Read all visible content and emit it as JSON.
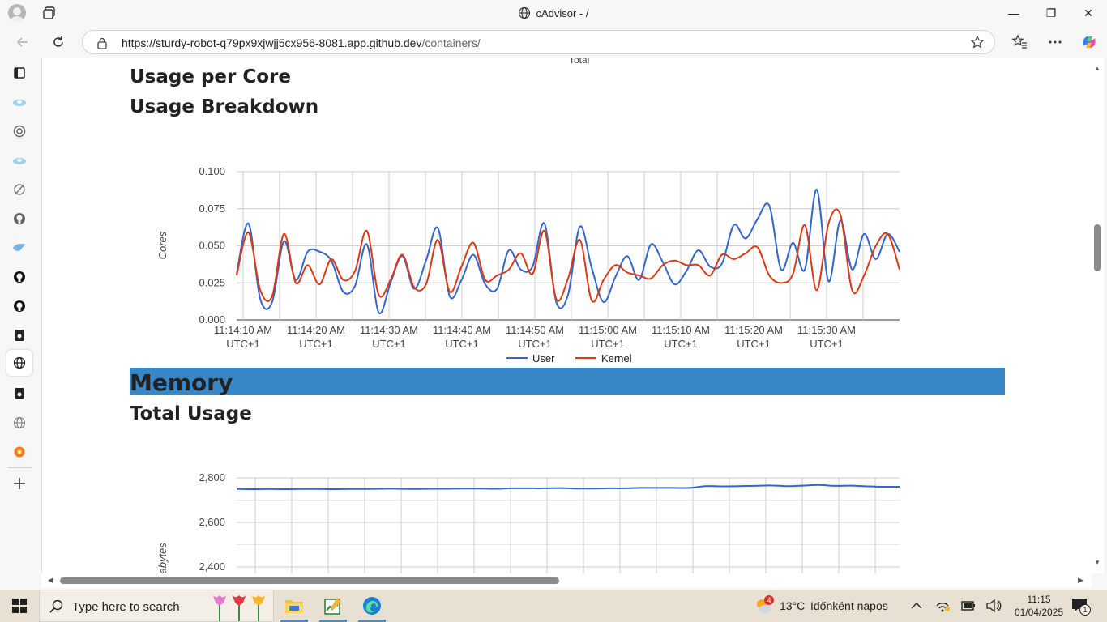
{
  "window": {
    "title": "cAdvisor - /",
    "minimize": "—",
    "maximize": "❐",
    "close": "✕"
  },
  "address": {
    "url_host": "https://sturdy-robot-q79px9xjwjj5cx956-8081.app.github.dev",
    "url_path": "/containers/"
  },
  "page": {
    "cut_label": "Total",
    "usage_per_core": "Usage per Core",
    "usage_breakdown": "Usage Breakdown",
    "memory_section": "Memory",
    "total_usage": "Total Usage"
  },
  "chart_data": [
    {
      "type": "line",
      "ylabel": "Cores",
      "ylim": [
        0,
        0.1
      ],
      "yticks": [
        "0.000",
        "0.025",
        "0.050",
        "0.075",
        "0.100"
      ],
      "xticks": [
        [
          "11:14:10 AM",
          "UTC+1"
        ],
        [
          "11:14:20 AM",
          "UTC+1"
        ],
        [
          "11:14:30 AM",
          "UTC+1"
        ],
        [
          "11:14:40 AM",
          "UTC+1"
        ],
        [
          "11:14:50 AM",
          "UTC+1"
        ],
        [
          "11:15:00 AM",
          "UTC+1"
        ],
        [
          "11:15:10 AM",
          "UTC+1"
        ],
        [
          "11:15:20 AM",
          "UTC+1"
        ],
        [
          "11:15:30 AM",
          "UTC+1"
        ]
      ],
      "legend": "bottom",
      "series": [
        {
          "name": "User",
          "color": "#3366cc",
          "values": [
            0.031,
            0.065,
            0.014,
            0.012,
            0.053,
            0.027,
            0.046,
            0.046,
            0.04,
            0.019,
            0.023,
            0.051,
            0.005,
            0.025,
            0.043,
            0.021,
            0.04,
            0.062,
            0.016,
            0.027,
            0.044,
            0.024,
            0.021,
            0.047,
            0.034,
            0.036,
            0.065,
            0.012,
            0.017,
            0.063,
            0.035,
            0.012,
            0.029,
            0.043,
            0.027,
            0.051,
            0.039,
            0.024,
            0.033,
            0.047,
            0.036,
            0.038,
            0.064,
            0.055,
            0.068,
            0.077,
            0.034,
            0.052,
            0.034,
            0.088,
            0.026,
            0.067,
            0.034,
            0.058,
            0.041,
            0.058,
            0.046
          ]
        },
        {
          "name": "Kernel",
          "color": "#dc3912",
          "values": [
            0.03,
            0.059,
            0.02,
            0.016,
            0.058,
            0.025,
            0.037,
            0.024,
            0.041,
            0.027,
            0.033,
            0.06,
            0.017,
            0.027,
            0.044,
            0.022,
            0.024,
            0.054,
            0.019,
            0.036,
            0.052,
            0.027,
            0.03,
            0.034,
            0.045,
            0.031,
            0.06,
            0.014,
            0.028,
            0.054,
            0.013,
            0.027,
            0.037,
            0.032,
            0.03,
            0.028,
            0.037,
            0.04,
            0.037,
            0.037,
            0.03,
            0.044,
            0.041,
            0.045,
            0.049,
            0.03,
            0.025,
            0.031,
            0.064,
            0.02,
            0.065,
            0.071,
            0.02,
            0.03,
            0.05,
            0.058,
            0.034
          ]
        }
      ]
    },
    {
      "type": "line",
      "ylabel": "Megabytes",
      "yticks": [
        "2,400",
        "2,600",
        "2,800"
      ],
      "ylim": [
        2400,
        2800
      ],
      "series": [
        {
          "name": "",
          "color": "#3366cc",
          "values": [
            2750,
            2749,
            2750,
            2749,
            2750,
            2750,
            2749,
            2750,
            2750,
            2751,
            2751,
            2750,
            2751,
            2751,
            2752,
            2752,
            2751,
            2753,
            2753,
            2753,
            2754,
            2752,
            2752,
            2753,
            2753,
            2755,
            2755,
            2755,
            2755,
            2763,
            2762,
            2763,
            2764,
            2766,
            2763,
            2765,
            2768,
            2764,
            2765,
            2762,
            2760,
            2760
          ]
        }
      ]
    }
  ],
  "taskbar": {
    "search_placeholder": "Type here to search",
    "weather_temp": "13°C",
    "weather_text": "Időnként napos",
    "weather_badge": "4",
    "time": "11:15",
    "date": "01/04/2025",
    "notif_count": "1"
  }
}
